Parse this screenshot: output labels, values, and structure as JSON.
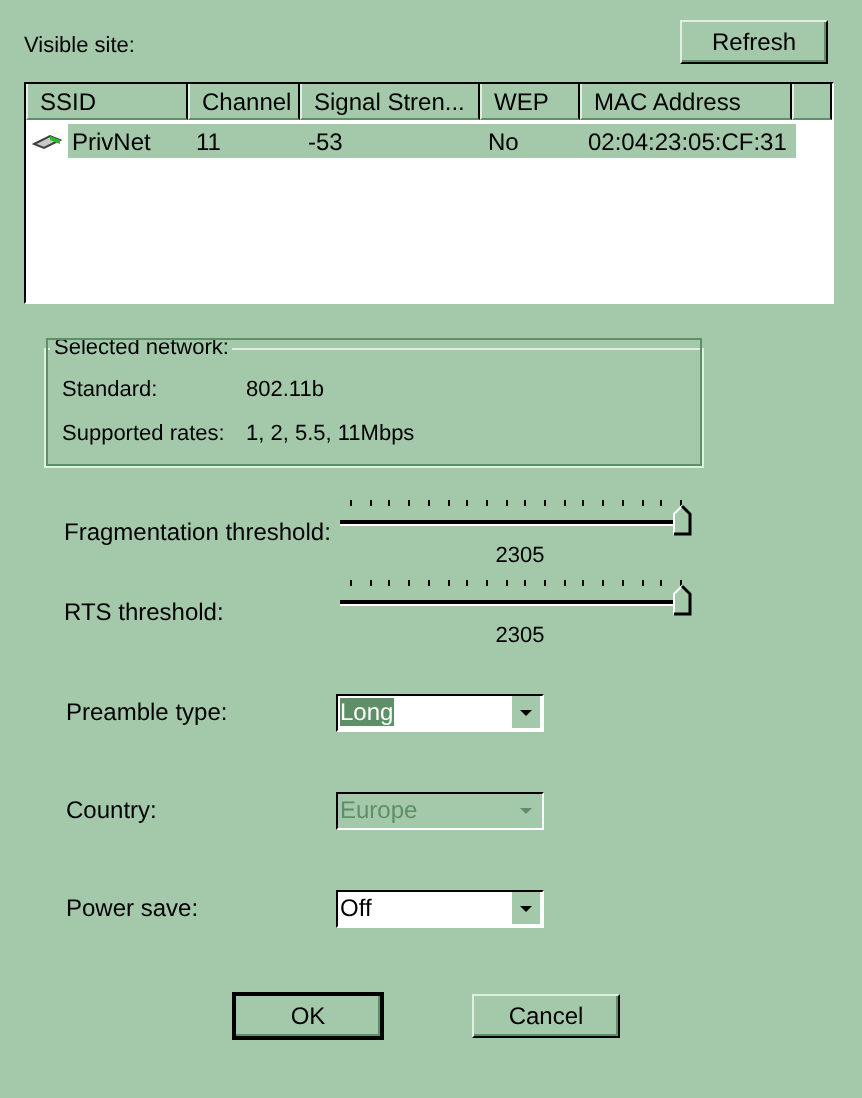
{
  "visible_site_label": "Visible site:",
  "refresh_button": "Refresh",
  "networks": {
    "columns": [
      "SSID",
      "Channel",
      "Signal Stren...",
      "WEP",
      "MAC Address"
    ],
    "rows": [
      {
        "selected": true,
        "cells": [
          "PrivNet",
          "11",
          "-53",
          "No",
          "02:04:23:05:CF:31"
        ]
      }
    ]
  },
  "selected_network": {
    "title": "Selected network:",
    "fields": [
      {
        "label": "Standard:",
        "value": "802.11b"
      },
      {
        "label": "Supported rates:",
        "value": "1, 2, 5.5, 11Mbps"
      }
    ]
  },
  "sliders": [
    {
      "label": "Fragmentation threshold:",
      "level": 1,
      "reading": "2305"
    },
    {
      "label": "RTS threshold:",
      "level": 1,
      "reading": "2305"
    }
  ],
  "dropdowns": [
    {
      "label": "Preamble type:",
      "value": "Long",
      "focused": true,
      "disabled": false
    },
    {
      "label": "Country:",
      "value": "Europe",
      "focused": false,
      "disabled": true
    },
    {
      "label": "Power save:",
      "value": "Off",
      "focused": false,
      "disabled": false
    }
  ],
  "buttons": [
    {
      "label": "OK",
      "default": true
    },
    {
      "label": "Cancel",
      "default": false
    }
  ]
}
